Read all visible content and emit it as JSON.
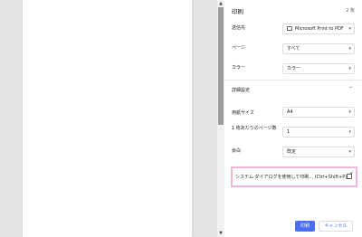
{
  "header": {
    "title": "印刷",
    "sheet_count": "2 枚"
  },
  "settings": {
    "destination": {
      "label": "送信先",
      "value": "Microsoft Print to PDF"
    },
    "pages": {
      "label": "ページ",
      "value": "すべて"
    },
    "color": {
      "label": "カラー",
      "value": "カラー"
    },
    "advanced_label": "詳細設定",
    "paper_size": {
      "label": "用紙サイズ",
      "value": "A4"
    },
    "pages_per_sheet": {
      "label": "1 枚あたりのページ数",
      "value": "1"
    },
    "margins": {
      "label": "余白",
      "value": "既定"
    }
  },
  "system_dialog": {
    "text": "システム ダイアログを使用して印刷... (Ctrl+Shift+P)"
  },
  "buttons": {
    "print": "印刷",
    "cancel": "キャンセル"
  },
  "colors": {
    "accent": "#4c6ef5",
    "highlight_border": "#f3b6d6"
  }
}
